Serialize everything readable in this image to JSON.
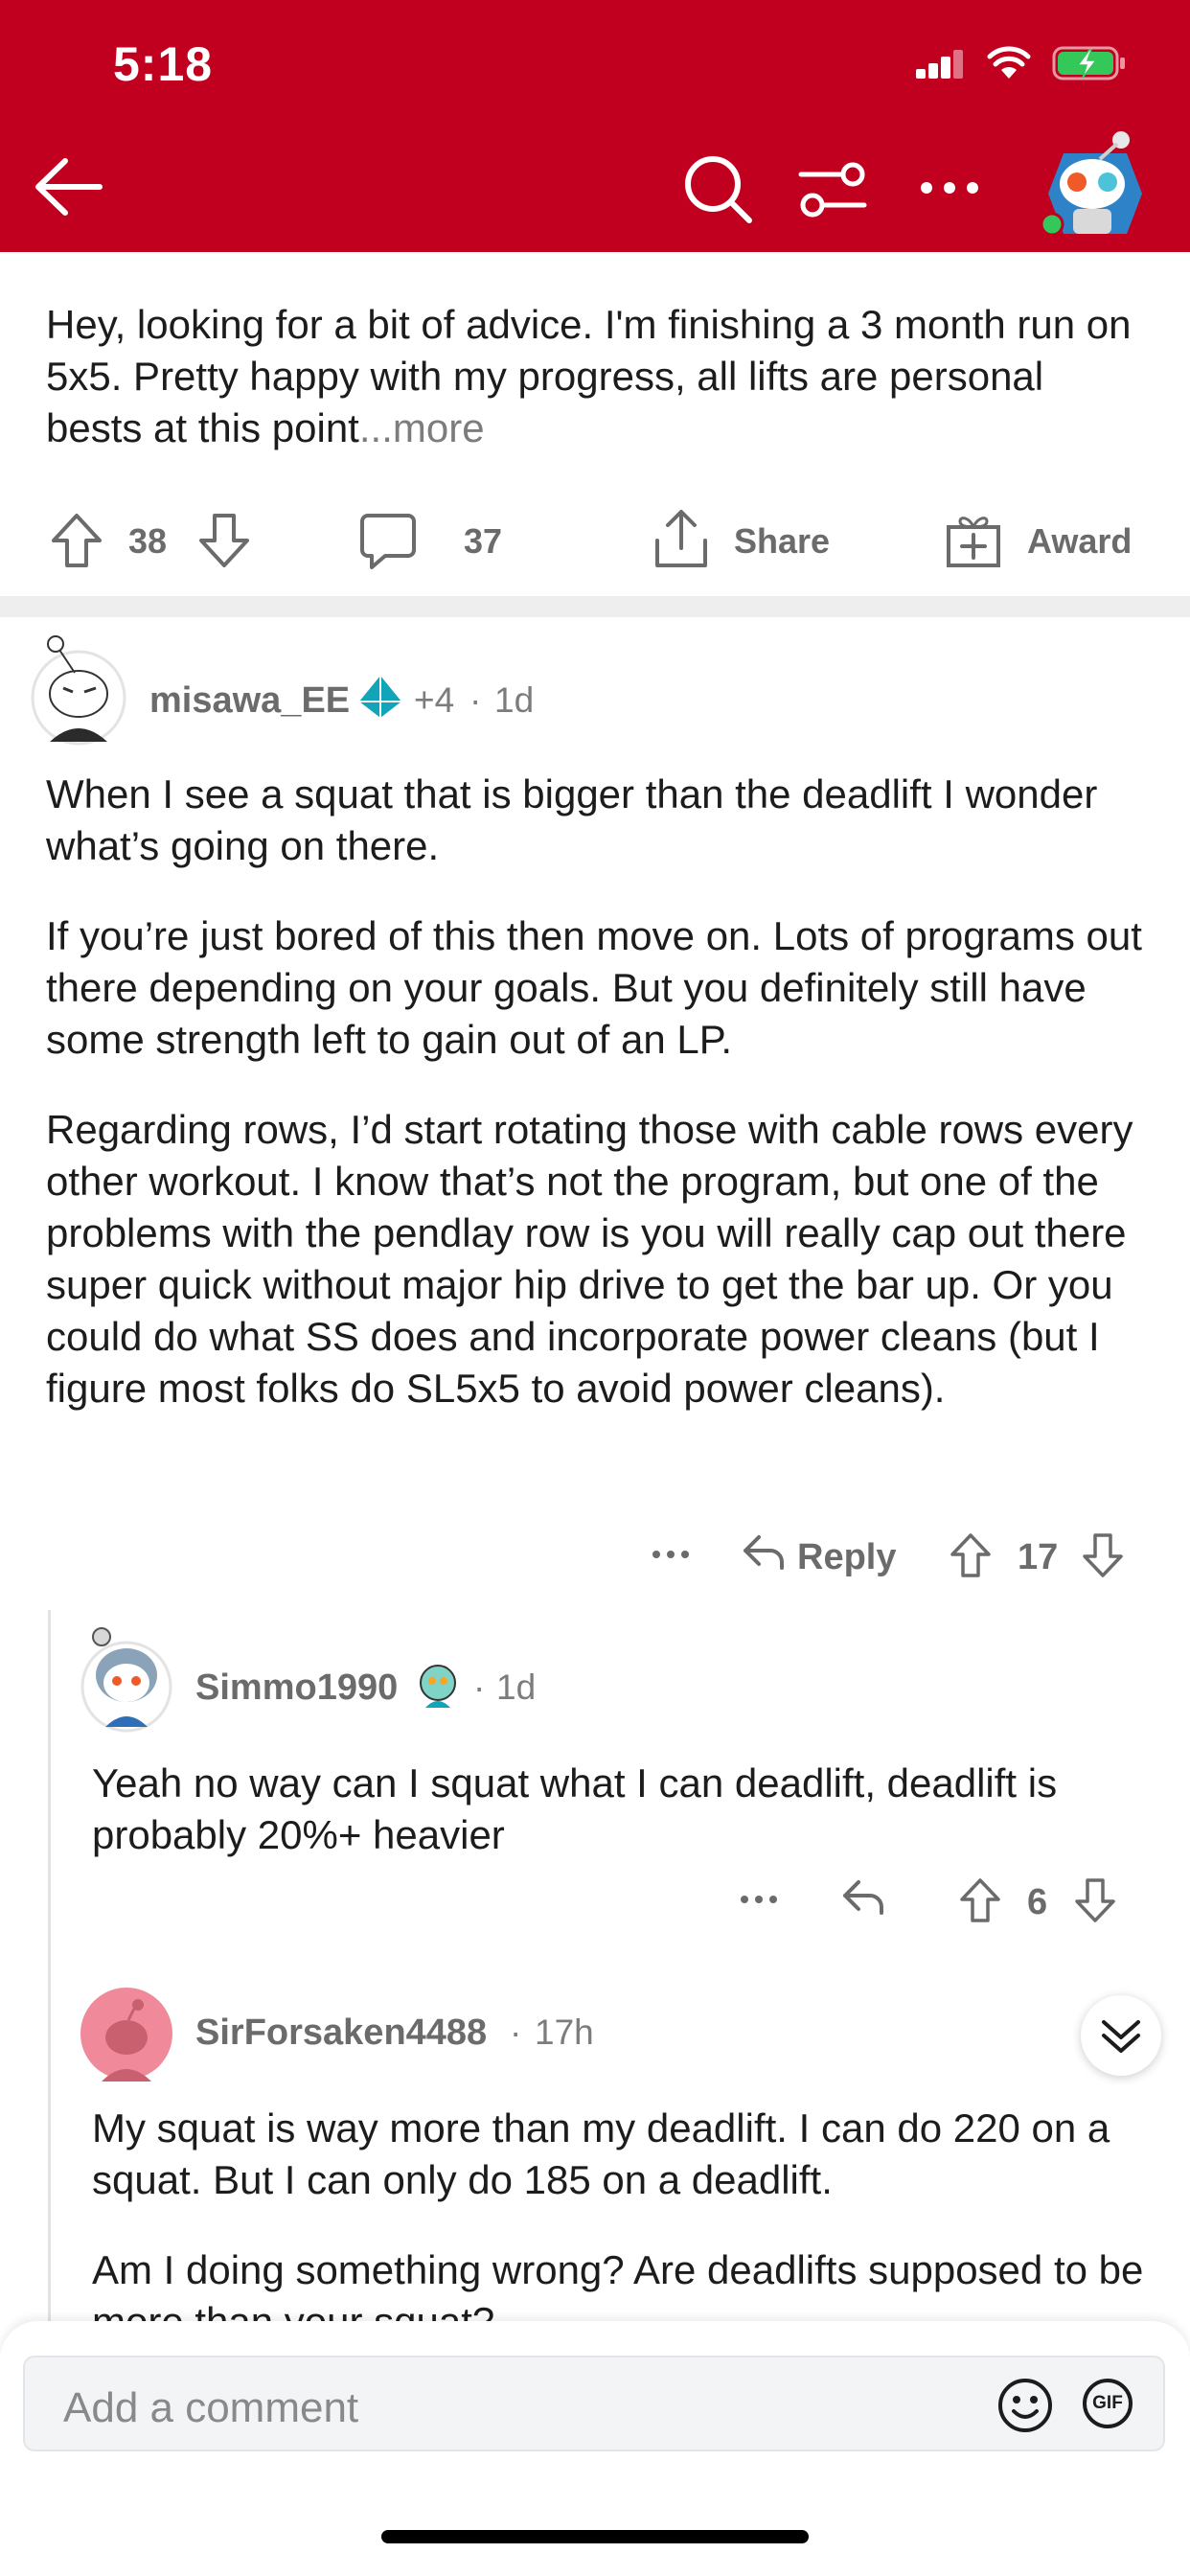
{
  "status_bar": {
    "time": "5:18"
  },
  "post": {
    "body": "Hey, looking for a bit of advice. I'm finishing a 3 month run on 5x5. Pretty happy with my progress, all lifts are personal bests at this point",
    "more_label": "...more",
    "votes": "38",
    "comments": "37",
    "share_label": "Share",
    "award_label": "Award"
  },
  "comments": [
    {
      "user": "misawa_EE",
      "karma_badge": "+4",
      "age": "1d",
      "paragraphs": [
        "When I see a squat that is bigger than the deadlift I wonder what’s going on there.",
        "If you’re just bored of this then move on. Lots of programs out there depending on your goals. But you definitely still have some strength left to gain out of an LP.",
        "Regarding rows, I’d start rotating those with cable rows every other workout. I know that’s not the program, but one of the problems with the pendlay row is you will really cap out there super quick without major hip drive to get the bar up. Or you could do what SS does and incorporate power cleans (but I figure most folks do SL5x5 to avoid power cleans)."
      ],
      "reply_label": "Reply",
      "votes": "17"
    },
    {
      "user": "Simmo1990",
      "age": "1d",
      "paragraphs": [
        "Yeah no way can I squat what I can deadlift, deadlift is probably 20%+ heavier"
      ],
      "votes": "6"
    },
    {
      "user": "SirForsaken4488",
      "age": "17h",
      "paragraphs": [
        "My squat is way more than my deadlift. I can do 220 on a squat. But I can only do 185 on a deadlift.",
        "Am I doing something wrong? Are deadlifts supposed to be more than your squat?"
      ]
    }
  ],
  "comment_bar": {
    "placeholder": "Add a comment",
    "gif_label": "GIF"
  },
  "colors": {
    "header": "#c1001f",
    "accent_teal": "#12a4b8",
    "battery": "#34c759"
  },
  "icons": [
    "back-arrow-icon",
    "search-icon",
    "sort-filter-icon",
    "more-icon",
    "upvote-icon",
    "downvote-icon",
    "comment-icon",
    "share-icon",
    "award-icon",
    "reply-icon",
    "collapse-chevron-icon",
    "emoji-icon",
    "gif-icon"
  ]
}
